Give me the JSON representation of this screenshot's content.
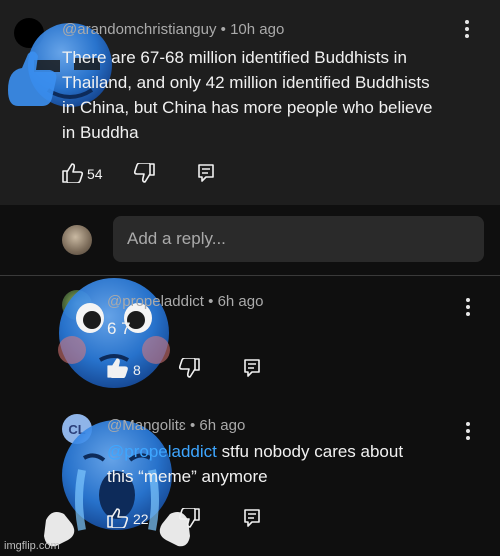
{
  "comment": {
    "handle": "@arandomchristianguy",
    "time": "10h ago",
    "lines": [
      "There are 67-68 million identified Buddhists in",
      "Thailand, and only 42 million identified Buddhists",
      "in China, but China has more people who believe",
      "in Buddha"
    ],
    "likes": "54"
  },
  "reply_box": {
    "placeholder": "Add a reply..."
  },
  "replies": [
    {
      "handle": "@propeladdict",
      "time": "6h ago",
      "text": "6 7",
      "likes": "8"
    },
    {
      "handle": "@Mangolitɛ",
      "time": "6h ago",
      "mention": "@propeladdict",
      "text_line1": " stfu nobody cares about",
      "text_line2": "this “meme” anymore",
      "likes": "22",
      "avatar_initials": "CL"
    }
  ],
  "separator": "•",
  "watermark": "imgflip.com",
  "colors": {
    "background": "#0f0f0f",
    "card": "#1e1e1e",
    "link": "#3ea6ff",
    "emoji_blue": "#2f8cff"
  },
  "icons": [
    "thumbs-up-icon",
    "thumbs-down-icon",
    "reply-icon",
    "more-vert-icon"
  ]
}
